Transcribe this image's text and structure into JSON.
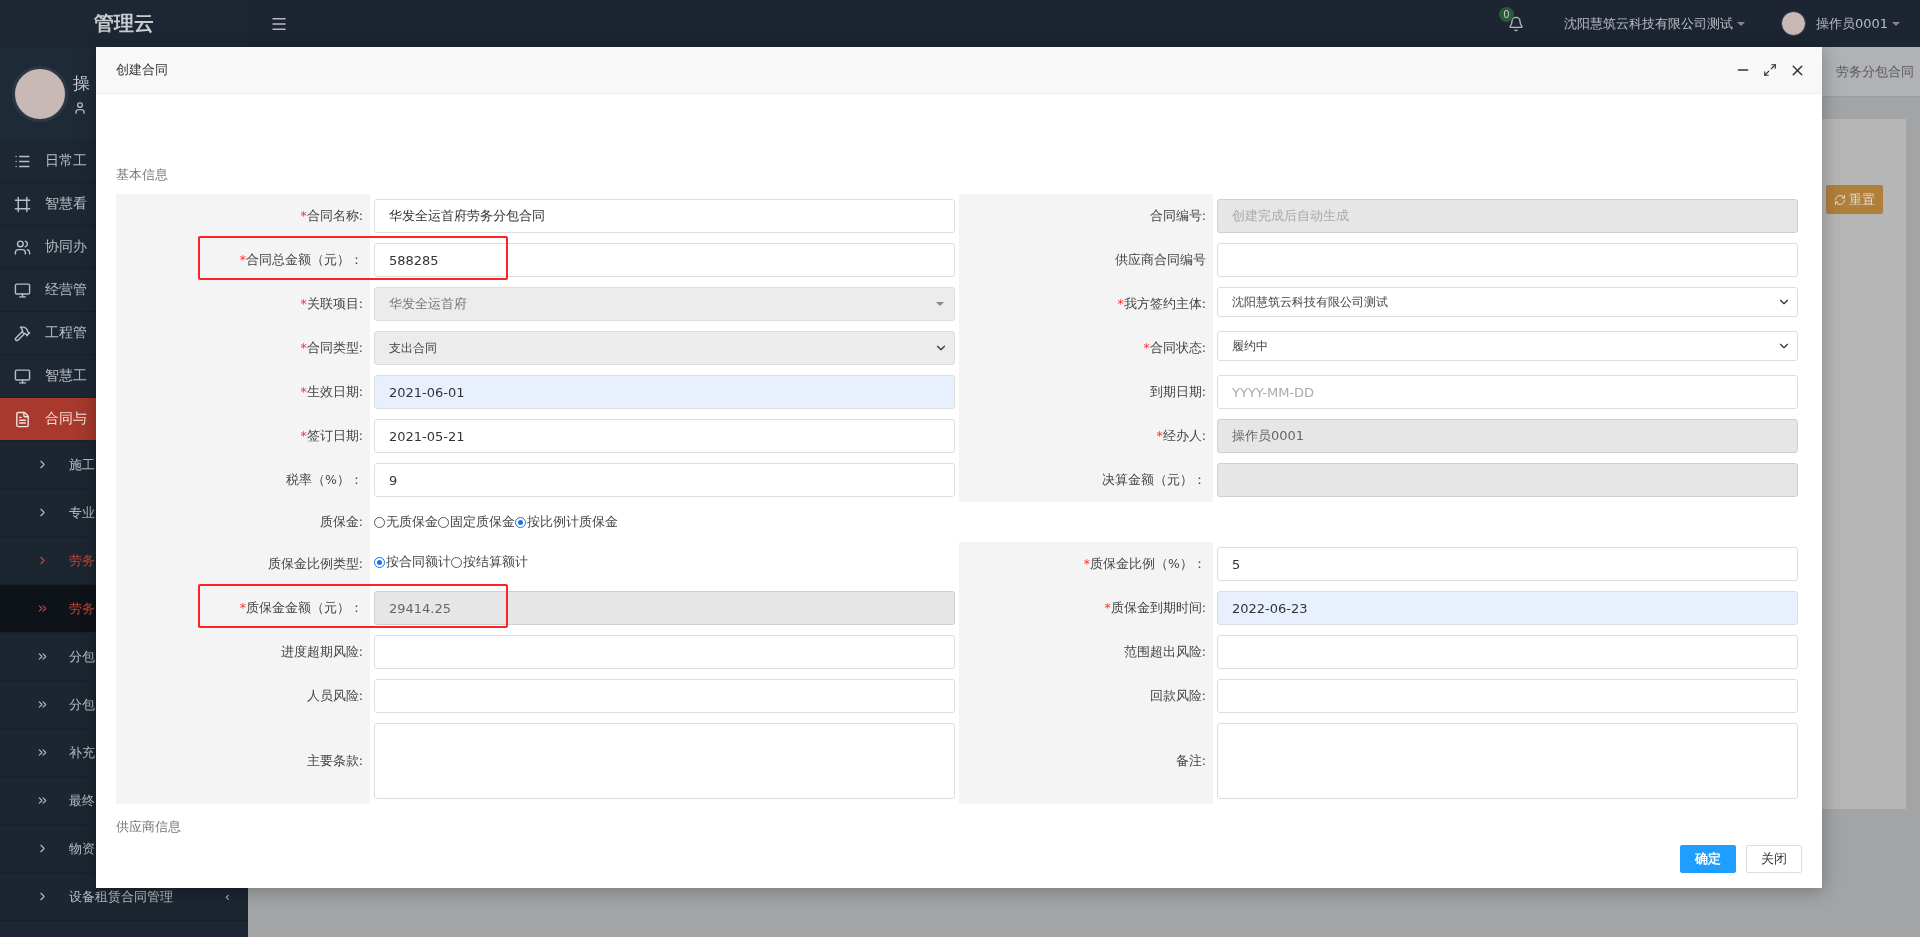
{
  "sidebar": {
    "logo": "管理云",
    "user_initial": "操",
    "items": [
      {
        "label": "日常工",
        "kind": "main",
        "selected": false
      },
      {
        "label": "智慧看",
        "kind": "main",
        "selected": false
      },
      {
        "label": "协同办",
        "kind": "main",
        "selected": false
      },
      {
        "label": "经营管",
        "kind": "main",
        "selected": false
      },
      {
        "label": "工程管",
        "kind": "main",
        "selected": false
      },
      {
        "label": "智慧工",
        "kind": "main",
        "selected": false
      },
      {
        "label": "合同与",
        "kind": "main",
        "selected": true
      },
      {
        "label": "施工",
        "kind": "sub",
        "selected": false,
        "current": false
      },
      {
        "label": "专业",
        "kind": "sub",
        "selected": false,
        "current": false
      },
      {
        "label": "劳务",
        "kind": "sub",
        "selected": false,
        "current": true
      },
      {
        "label": "劳务",
        "kind": "leaf",
        "selected": true,
        "current": true
      },
      {
        "label": "分包",
        "kind": "leaf",
        "selected": false,
        "current": false
      },
      {
        "label": "分包",
        "kind": "leaf",
        "selected": false,
        "current": false
      },
      {
        "label": "补充",
        "kind": "leaf",
        "selected": false,
        "current": false
      },
      {
        "label": "最终",
        "kind": "leaf",
        "selected": false,
        "current": false
      },
      {
        "label": "物资",
        "kind": "sub",
        "selected": false,
        "current": false
      },
      {
        "label": "设备租赁合同管理",
        "kind": "sub",
        "selected": false,
        "current": false,
        "submenu": "‹"
      }
    ]
  },
  "topbar": {
    "notifications": "0",
    "company": "沈阳慧筑云科技有限公司测试",
    "user": "操作员0001"
  },
  "background": {
    "tab": "劳务分包合同",
    "reset_button": "重置"
  },
  "dialog": {
    "title": "创建合同",
    "section": "基本信息",
    "next_section": "供应商信息",
    "rows": [
      {
        "left": {
          "marker": "*",
          "label": "合同名称:",
          "kind": "text",
          "value": "华发全运首府劳务分包合同",
          "disabled": false,
          "autofilled": false
        },
        "right": {
          "label": "合同编号:",
          "kind": "text",
          "placeholder": "创建完成后自动生成",
          "disabled": true,
          "autofilled": false
        }
      },
      {
        "left": {
          "marker": "*",
          "label": "合同总金额（元）：",
          "kind": "text",
          "value": "588285",
          "disabled": false,
          "autofilled": false,
          "annotated": true
        },
        "right": {
          "label": "供应商合同编号",
          "kind": "text",
          "disabled": false,
          "autofilled": false
        }
      },
      {
        "left": {
          "marker": "*",
          "label": "关联项目:",
          "kind": "combo",
          "value": "华发全运首府",
          "disabled": true
        },
        "right": {
          "marker": "*",
          "label": "我方签约主体:",
          "kind": "select",
          "value": "沈阳慧筑云科技有限公司测试",
          "disabled": false
        }
      },
      {
        "left": {
          "marker": "*",
          "label": "合同类型:",
          "kind": "select",
          "value": "支出合同",
          "disabled": true
        },
        "right": {
          "marker": "*",
          "label": "合同状态:",
          "kind": "select",
          "value": "履约中",
          "disabled": false
        }
      },
      {
        "left": {
          "marker": "*",
          "label": "生效日期:",
          "kind": "text",
          "value": "2021-06-01",
          "disabled": false,
          "autofilled": true
        },
        "right": {
          "label": "到期日期:",
          "kind": "text",
          "placeholder": "YYYY-MM-DD",
          "disabled": false,
          "autofilled": false
        }
      },
      {
        "left": {
          "marker": "*",
          "label": "签订日期:",
          "kind": "text",
          "value": "2021-05-21",
          "disabled": false,
          "autofilled": false
        },
        "right": {
          "marker": "*",
          "label": "经办人:",
          "kind": "text",
          "value": "操作员0001",
          "disabled": true,
          "autofilled": false
        }
      },
      {
        "left": {
          "label": "税率（%）：",
          "kind": "text",
          "value": "9",
          "disabled": false,
          "autofilled": false
        },
        "right": {
          "label": "决算金额（元）：",
          "kind": "text",
          "disabled": true,
          "autofilled": false
        }
      },
      {
        "left": {
          "label": "质保金:",
          "kind": "radio",
          "options": [
            {
              "label": "无质保金",
              "selected": false
            },
            {
              "label": "固定质保金",
              "selected": false
            },
            {
              "label": "按比例计质保金",
              "selected": true
            }
          ]
        }
      },
      {
        "left": {
          "label": "质保金比例类型:",
          "kind": "radio",
          "options": [
            {
              "label": "按合同额计",
              "selected": true
            },
            {
              "label": "按结算额计",
              "selected": false
            }
          ]
        },
        "right": {
          "marker": "*",
          "label": "质保金比例（%）：",
          "kind": "text",
          "value": "5",
          "disabled": false,
          "autofilled": false
        }
      },
      {
        "left": {
          "marker": "*",
          "label": "质保金金额（元）：",
          "kind": "text",
          "value": "29414.25",
          "disabled": true,
          "autofilled": false,
          "annotated": true
        },
        "right": {
          "marker": "*",
          "label": "质保金到期时间:",
          "kind": "text",
          "value": "2022-06-23",
          "disabled": false,
          "autofilled": true
        }
      },
      {
        "left": {
          "label": "进度超期风险:",
          "kind": "text",
          "disabled": false,
          "autofilled": false
        },
        "right": {
          "label": "范围超出风险:",
          "kind": "text",
          "disabled": false,
          "autofilled": false
        }
      },
      {
        "left": {
          "label": "人员风险:",
          "kind": "text",
          "disabled": false,
          "autofilled": false
        },
        "right": {
          "label": "回款风险:",
          "kind": "text",
          "disabled": false,
          "autofilled": false
        }
      },
      {
        "left": {
          "label": "主要条款:",
          "kind": "textarea"
        },
        "right": {
          "label": "备注:",
          "kind": "textarea"
        }
      }
    ],
    "buttons": [
      {
        "label": "确定",
        "kind": "primary"
      },
      {
        "label": "关闭",
        "kind": "default"
      }
    ]
  }
}
